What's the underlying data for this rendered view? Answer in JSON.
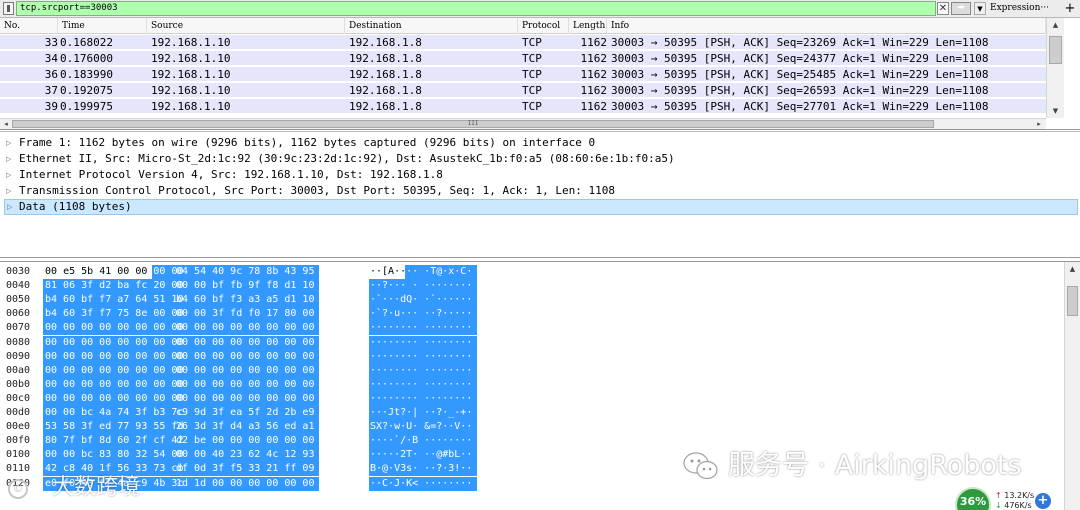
{
  "filter": {
    "value": "tcp.srcport==30003",
    "clear_icon": "clear-x-icon",
    "apply_icon": "arrow-right-icon",
    "expression_label": "Expression···",
    "add_label": "+"
  },
  "packet_list": {
    "columns": [
      "No.",
      "Time",
      "Source",
      "Destination",
      "Protocol",
      "Length",
      "Info"
    ],
    "row_color": "#e6e6fa",
    "rows": [
      {
        "no": "33",
        "time": "0.168022",
        "source": "192.168.1.10",
        "destination": "192.168.1.8",
        "protocol": "TCP",
        "length": "1162",
        "info": "30003 → 50395 [PSH, ACK] Seq=23269 Ack=1 Win=229 Len=1108"
      },
      {
        "no": "34",
        "time": "0.176000",
        "source": "192.168.1.10",
        "destination": "192.168.1.8",
        "protocol": "TCP",
        "length": "1162",
        "info": "30003 → 50395 [PSH, ACK] Seq=24377 Ack=1 Win=229 Len=1108"
      },
      {
        "no": "36",
        "time": "0.183990",
        "source": "192.168.1.10",
        "destination": "192.168.1.8",
        "protocol": "TCP",
        "length": "1162",
        "info": "30003 → 50395 [PSH, ACK] Seq=25485 Ack=1 Win=229 Len=1108"
      },
      {
        "no": "37",
        "time": "0.192075",
        "source": "192.168.1.10",
        "destination": "192.168.1.8",
        "protocol": "TCP",
        "length": "1162",
        "info": "30003 → 50395 [PSH, ACK] Seq=26593 Ack=1 Win=229 Len=1108"
      },
      {
        "no": "39",
        "time": "0.199975",
        "source": "192.168.1.10",
        "destination": "192.168.1.8",
        "protocol": "TCP",
        "length": "1162",
        "info": "30003 → 50395 [PSH, ACK] Seq=27701 Ack=1 Win=229 Len=1108"
      }
    ],
    "hscroll_grip": "III"
  },
  "details": {
    "rows": [
      {
        "text": "Frame 1: 1162 bytes on wire (9296 bits), 1162 bytes captured (9296 bits) on interface 0",
        "selected": false
      },
      {
        "text": "Ethernet II, Src: Micro-St_2d:1c:92 (30:9c:23:2d:1c:92), Dst: AsustekC_1b:f0:a5 (08:60:6e:1b:f0:a5)",
        "selected": false
      },
      {
        "text": "Internet Protocol Version 4, Src: 192.168.1.10, Dst: 192.168.1.8",
        "selected": false
      },
      {
        "text": "Transmission Control Protocol, Src Port: 30003, Dst Port: 50395, Seq: 1, Ack: 1, Len: 1108",
        "selected": false
      },
      {
        "text": "Data (1108 bytes)",
        "selected": true
      }
    ],
    "selected_bg": "#cce8ff"
  },
  "bytes": {
    "highlight_color": "#3399ff",
    "rows": [
      {
        "offset": "0030",
        "hex1": "00 e5 5b 41 00 00 00 00",
        "hex2": "04 54 40 9c 78 8b 43 95",
        "ascii": "··[A···· ·T@·x·C·"
      },
      {
        "offset": "0040",
        "hex1": "81 06 3f d2 ba fc 20 00",
        "hex2": "00 00 bf fb 9f f8 d1 10",
        "ascii": "··?··· · ········"
      },
      {
        "offset": "0050",
        "hex1": "b4 60 bf f7 a7 64 51 10",
        "hex2": "b4 60 bf f3 a3 a5 d1 10",
        "ascii": "·`···dQ· ·`······"
      },
      {
        "offset": "0060",
        "hex1": "b4 60 3f f7 75 8e 00 00",
        "hex2": "00 00 3f fd f0 17 80 00",
        "ascii": "·`?·u··· ··?·····"
      },
      {
        "offset": "0070",
        "hex1": "00 00 00 00 00 00 00 00",
        "hex2": "00 00 00 00 00 00 00 00",
        "ascii": "········ ········"
      },
      {
        "offset": "0080",
        "hex1": "00 00 00 00 00 00 00 00",
        "hex2": "00 00 00 00 00 00 00 00",
        "ascii": "········ ········"
      },
      {
        "offset": "0090",
        "hex1": "00 00 00 00 00 00 00 00",
        "hex2": "00 00 00 00 00 00 00 00",
        "ascii": "········ ········"
      },
      {
        "offset": "00a0",
        "hex1": "00 00 00 00 00 00 00 00",
        "hex2": "00 00 00 00 00 00 00 00",
        "ascii": "········ ········"
      },
      {
        "offset": "00b0",
        "hex1": "00 00 00 00 00 00 00 00",
        "hex2": "00 00 00 00 00 00 00 00",
        "ascii": "········ ········"
      },
      {
        "offset": "00c0",
        "hex1": "00 00 00 00 00 00 00 00",
        "hex2": "00 00 00 00 00 00 00 00",
        "ascii": "········ ········"
      },
      {
        "offset": "00d0",
        "hex1": "00 00 bc 4a 74 3f b3 7c",
        "hex2": "c9 9d 3f ea 5f 2d 2b e9",
        "ascii": "···Jt?·| ··?·_-+·"
      },
      {
        "offset": "00e0",
        "hex1": "53 58 3f ed 77 93 55 fd",
        "hex2": "26 3d 3f d4 a3 56 ed a1",
        "ascii": "SX?·w·U· &=?··V··"
      },
      {
        "offset": "00f0",
        "hex1": "80 7f bf 8d 60 2f cf 42",
        "hex2": "d2 be 00 00 00 00 00 00",
        "ascii": "····`/·B ········"
      },
      {
        "offset": "0100",
        "hex1": "00 00 bc 83 80 32 54 00",
        "hex2": "00 00 40 23 62 4c 12 93",
        "ascii": "·····2T· ··@#bL··"
      },
      {
        "offset": "0110",
        "hex1": "42 c8 40 1f 56 33 73 cb",
        "hex2": "df 0d 3f f5 33 21 ff 09",
        "ascii": "B·@·V3s· ··?·3!··"
      },
      {
        "offset": "0120",
        "hex1": "e0 f0 43 ff 4a c9 4b 3c",
        "hex2": "1d 1d 00 00 00 00 00 00",
        "ascii": "··C·J·K< ········"
      }
    ]
  },
  "watermark": {
    "text": "服务号 · AirkingRobots",
    "corner_icon": "copyright-icon",
    "corner_symbol": "©",
    "corner_text": "大数跨境"
  },
  "speed": {
    "percent": "36%",
    "up": "13.2K/s",
    "down": "476K/s",
    "plus": "+"
  }
}
